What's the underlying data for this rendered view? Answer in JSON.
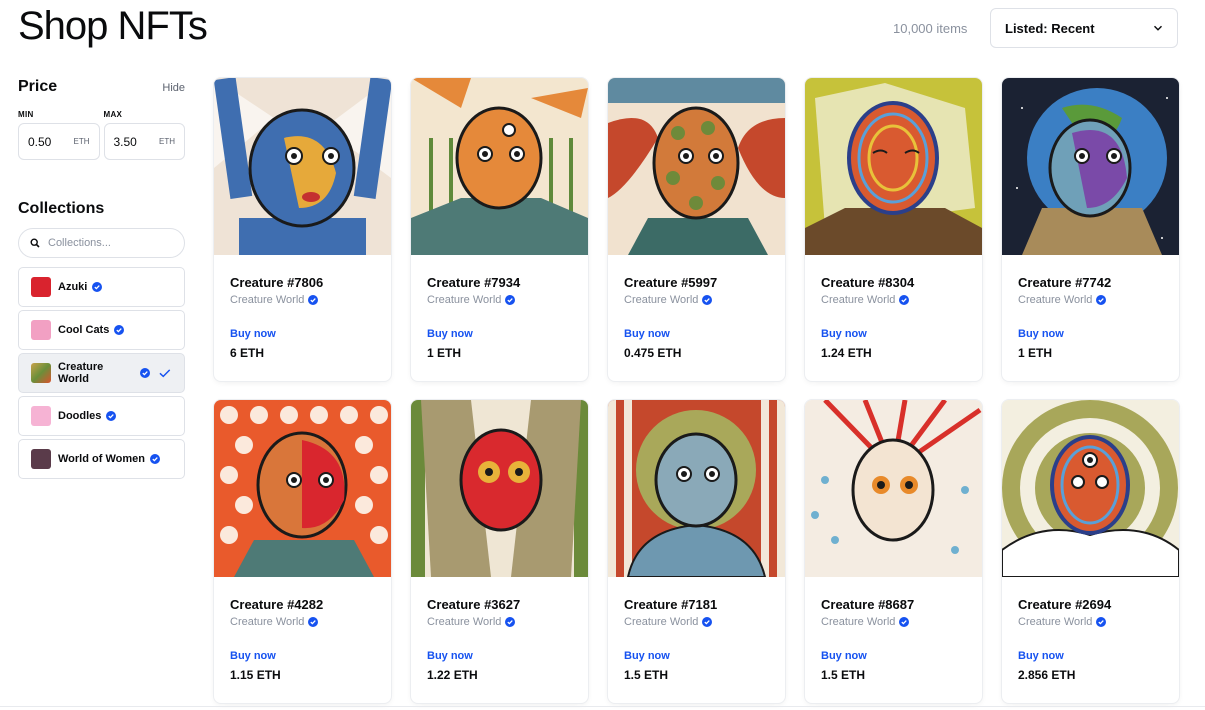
{
  "header": {
    "title": "Shop NFTs",
    "items_count": "10,000 items",
    "sort_label": "Listed: Recent"
  },
  "sidebar": {
    "price_title": "Price",
    "hide_label": "Hide",
    "min_label": "MIN",
    "max_label": "MAX",
    "min_value": "0.50",
    "max_value": "3.50",
    "unit": "ETH",
    "collections_title": "Collections",
    "search_placeholder": "Collections...",
    "collections": [
      {
        "name": "Azuki",
        "selected": false,
        "thumb_color": "#d9232e",
        "icon": "azuki-thumb"
      },
      {
        "name": "Cool Cats",
        "selected": false,
        "thumb_color": "#f2a0c3",
        "icon": "cool-cats-thumb"
      },
      {
        "name": "Creature World",
        "selected": true,
        "thumb_color": "#c9a24a",
        "icon": "creature-world-thumb"
      },
      {
        "name": "Doodles",
        "selected": false,
        "thumb_color": "#f6b3d4",
        "icon": "doodles-thumb"
      },
      {
        "name": "World of Women",
        "selected": false,
        "thumb_color": "#5a3b4a",
        "icon": "world-of-women-thumb"
      }
    ]
  },
  "cards": [
    {
      "name": "Creature #7806",
      "collection": "Creature World",
      "buy": "Buy now",
      "price": "6 ETH"
    },
    {
      "name": "Creature #7934",
      "collection": "Creature World",
      "buy": "Buy now",
      "price": "1 ETH"
    },
    {
      "name": "Creature #5997",
      "collection": "Creature World",
      "buy": "Buy now",
      "price": "0.475 ETH"
    },
    {
      "name": "Creature #8304",
      "collection": "Creature World",
      "buy": "Buy now",
      "price": "1.24 ETH"
    },
    {
      "name": "Creature #7742",
      "collection": "Creature World",
      "buy": "Buy now",
      "price": "1 ETH"
    },
    {
      "name": "Creature #4282",
      "collection": "Creature World",
      "buy": "Buy now",
      "price": "1.15 ETH"
    },
    {
      "name": "Creature #3627",
      "collection": "Creature World",
      "buy": "Buy now",
      "price": "1.22 ETH"
    },
    {
      "name": "Creature #7181",
      "collection": "Creature World",
      "buy": "Buy now",
      "price": "1.5 ETH"
    },
    {
      "name": "Creature #8687",
      "collection": "Creature World",
      "buy": "Buy now",
      "price": "1.5 ETH"
    },
    {
      "name": "Creature #2694",
      "collection": "Creature World",
      "buy": "Buy now",
      "price": "2.856 ETH"
    }
  ],
  "colors": {
    "accent": "#1652f0",
    "verified": "#1652f0",
    "muted": "#8a919e",
    "border": "#dee1e7"
  }
}
